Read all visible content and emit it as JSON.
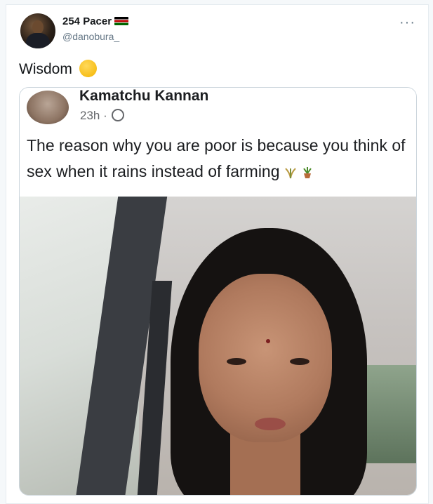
{
  "tweet": {
    "display_name": "254 Pacer",
    "handle": "@danobura_",
    "more_label": "···",
    "text": "Wisdom"
  },
  "icons": {
    "flag": "kenya-flag-icon",
    "text_emoji": "thinking-face-emoji",
    "more": "more-options-icon",
    "globe": "globe-icon",
    "farming_emojis": [
      "sheaf-of-rice-emoji",
      "potted-plant-emoji"
    ]
  },
  "embedded_post": {
    "author": "Kamatchu Kannan",
    "time": "23h ·",
    "text": "The reason why you are poor is because you think of sex when it rains instead of farming"
  },
  "colors": {
    "name": "#14171a",
    "secondary": "#657786",
    "border": "#ccd6dd"
  }
}
